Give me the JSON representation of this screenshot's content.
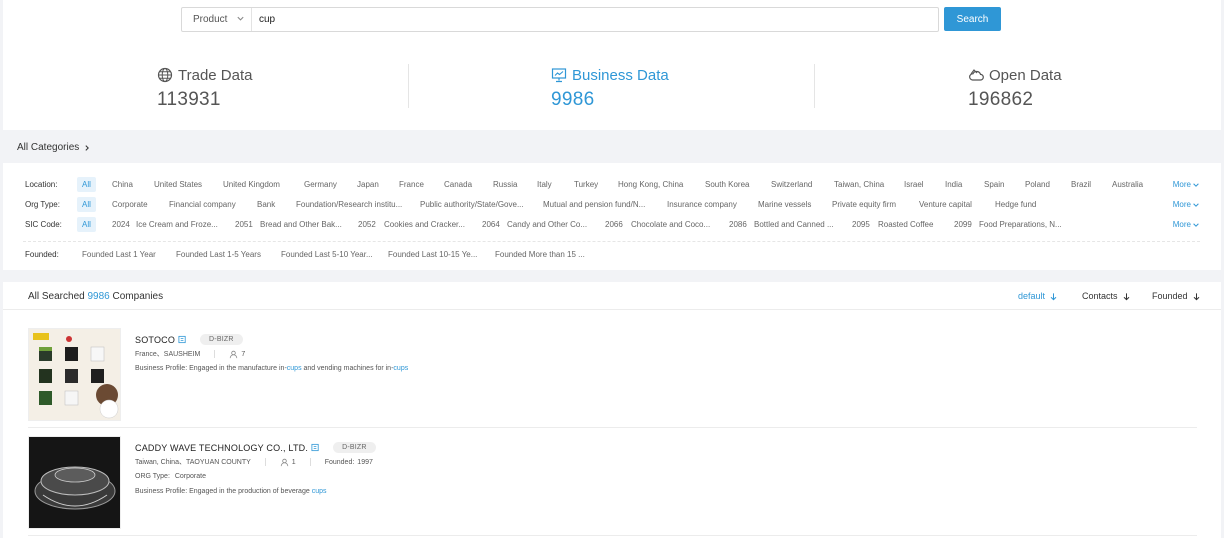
{
  "search": {
    "type_label": "Product",
    "query": "cup",
    "button": "Search"
  },
  "stats": [
    {
      "title": "Trade Data",
      "value": "113931",
      "icon": "globe-icon"
    },
    {
      "title": "Business Data",
      "value": "9986",
      "icon": "presentation-icon"
    },
    {
      "title": "Open Data",
      "value": "196862",
      "icon": "cloud-icon"
    }
  ],
  "categories": {
    "label": "All Categories"
  },
  "filters": {
    "all_label": "All",
    "more_label": "More",
    "location": {
      "label": "Location:",
      "items": [
        "China",
        "United States",
        "United Kingdom",
        "Germany",
        "Japan",
        "France",
        "Canada",
        "Russia",
        "Italy",
        "Turkey",
        "Hong Kong, China",
        "South Korea",
        "Switzerland",
        "Taiwan, China",
        "Israel",
        "India",
        "Spain",
        "Poland",
        "Brazil",
        "Australia"
      ]
    },
    "org_type": {
      "label": "Org Type:",
      "items": [
        "Corporate",
        "Financial company",
        "Bank",
        "Foundation/Research institu...",
        "Public authority/State/Gove...",
        "Mutual and pension fund/N...",
        "Insurance company",
        "Marine vessels",
        "Private equity firm",
        "Venture capital",
        "Hedge fund"
      ]
    },
    "sic_code": {
      "label": "SIC Code:",
      "items": [
        {
          "code": "2024",
          "name": "Ice Cream and Froze..."
        },
        {
          "code": "2051",
          "name": "Bread and Other Bak..."
        },
        {
          "code": "2052",
          "name": "Cookies and Cracker..."
        },
        {
          "code": "2064",
          "name": "Candy and Other Co..."
        },
        {
          "code": "2066",
          "name": "Chocolate and Coco..."
        },
        {
          "code": "2086",
          "name": "Bottled and Canned ..."
        },
        {
          "code": "2095",
          "name": "Roasted Coffee"
        },
        {
          "code": "2099",
          "name": "Food Preparations, N..."
        }
      ]
    },
    "founded": {
      "label": "Founded:",
      "items": [
        "Founded Last 1 Year",
        "Founded Last 1-5 Years",
        "Founded Last 5-10 Year...",
        "Founded Last 10-15 Ye...",
        "Founded More than 15 ..."
      ]
    }
  },
  "results": {
    "prefix": "All Searched",
    "count": "9986",
    "suffix": "Companies",
    "sort": {
      "default": "default",
      "contacts": "Contacts",
      "founded": "Founded"
    }
  },
  "companies": [
    {
      "name": "SOTOCO",
      "badge": "D-BIZR",
      "location": "France、SAUSHEIM",
      "contacts": "7",
      "profile_label": "Business Profile:",
      "profile_a": "Engaged in the manufacture in-",
      "kw1": "cups",
      "profile_b": " and vending machines for in-",
      "kw2": "cups"
    },
    {
      "name": "CADDY WAVE TECHNOLOGY CO., LTD.",
      "badge": "D-BIZR",
      "location": "Taiwan, China、TAOYUAN COUNTY",
      "contacts": "1",
      "founded_label": "Founded:",
      "founded": "1997",
      "org_label": "ORG Type:",
      "org": "Corporate",
      "profile_label": "Business Profile:",
      "profile_a": "Engaged in the production of beverage ",
      "kw1": "cups"
    }
  ],
  "colors": {
    "accent": "#2f97d6",
    "band": "#f2f3f6"
  }
}
